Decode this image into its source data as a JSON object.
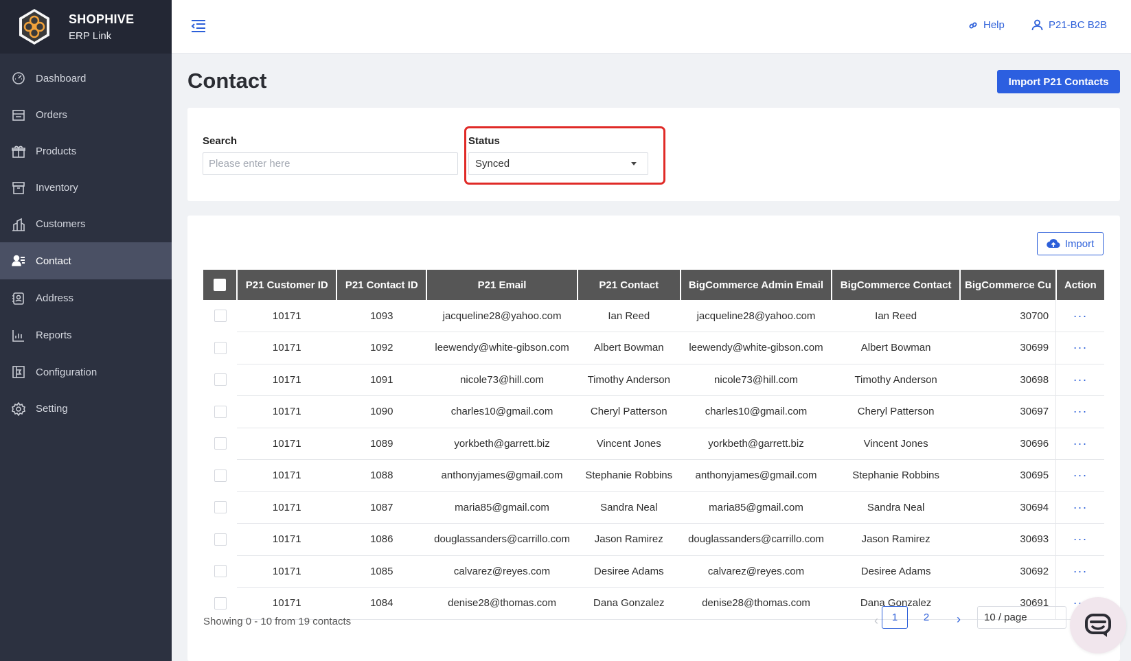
{
  "brand": {
    "name": "SHOPHIVE",
    "sub": "ERP Link"
  },
  "sidebar": {
    "items": [
      {
        "label": "Dashboard",
        "icon": "dashboard-icon",
        "active": false
      },
      {
        "label": "Orders",
        "icon": "orders-icon",
        "active": false
      },
      {
        "label": "Products",
        "icon": "products-icon",
        "active": false
      },
      {
        "label": "Inventory",
        "icon": "inventory-icon",
        "active": false
      },
      {
        "label": "Customers",
        "icon": "customers-icon",
        "active": false
      },
      {
        "label": "Contact",
        "icon": "contact-icon",
        "active": true
      },
      {
        "label": "Address",
        "icon": "address-icon",
        "active": false
      },
      {
        "label": "Reports",
        "icon": "reports-icon",
        "active": false
      },
      {
        "label": "Configuration",
        "icon": "configuration-icon",
        "active": false
      },
      {
        "label": "Setting",
        "icon": "setting-icon",
        "active": false
      }
    ]
  },
  "header": {
    "help_label": "Help",
    "user_label": "P21-BC B2B"
  },
  "page": {
    "title": "Contact",
    "import_contacts_label": "Import P21 Contacts"
  },
  "filters": {
    "search_label": "Search",
    "search_placeholder": "Please enter here",
    "search_value": "",
    "status_label": "Status",
    "status_value": "Synced"
  },
  "table": {
    "import_label": "Import",
    "columns": [
      "P21 Customer ID",
      "P21 Contact ID",
      "P21 Email",
      "P21 Contact",
      "BigCommerce Admin Email",
      "BigCommerce Contact",
      "BigCommerce Cu",
      "Action"
    ],
    "rows": [
      [
        "10171",
        "1093",
        "jacqueline28@yahoo.com",
        "Ian Reed",
        "jacqueline28@yahoo.com",
        "Ian Reed",
        "30700"
      ],
      [
        "10171",
        "1092",
        "leewendy@white-gibson.com",
        "Albert Bowman",
        "leewendy@white-gibson.com",
        "Albert Bowman",
        "30699"
      ],
      [
        "10171",
        "1091",
        "nicole73@hill.com",
        "Timothy Anderson",
        "nicole73@hill.com",
        "Timothy Anderson",
        "30698"
      ],
      [
        "10171",
        "1090",
        "charles10@gmail.com",
        "Cheryl Patterson",
        "charles10@gmail.com",
        "Cheryl Patterson",
        "30697"
      ],
      [
        "10171",
        "1089",
        "yorkbeth@garrett.biz",
        "Vincent Jones",
        "yorkbeth@garrett.biz",
        "Vincent Jones",
        "30696"
      ],
      [
        "10171",
        "1088",
        "anthonyjames@gmail.com",
        "Stephanie Robbins",
        "anthonyjames@gmail.com",
        "Stephanie Robbins",
        "30695"
      ],
      [
        "10171",
        "1087",
        "maria85@gmail.com",
        "Sandra Neal",
        "maria85@gmail.com",
        "Sandra Neal",
        "30694"
      ],
      [
        "10171",
        "1086",
        "douglassanders@carrillo.com",
        "Jason Ramirez",
        "douglassanders@carrillo.com",
        "Jason Ramirez",
        "30693"
      ],
      [
        "10171",
        "1085",
        "calvarez@reyes.com",
        "Desiree Adams",
        "calvarez@reyes.com",
        "Desiree Adams",
        "30692"
      ],
      [
        "10171",
        "1084",
        "denise28@thomas.com",
        "Dana Gonzalez",
        "denise28@thomas.com",
        "Dana Gonzalez",
        "30691"
      ]
    ],
    "action_label": "···"
  },
  "pagination": {
    "showing": "Showing 0 - 10 from 19 contacts",
    "pages": [
      "1",
      "2"
    ],
    "current": "1",
    "page_size": "10 / page"
  },
  "colors": {
    "accent": "#2c5fe0",
    "sidebar_bg": "#2c3140",
    "header_row": "#565656",
    "highlight": "#e02a27"
  }
}
